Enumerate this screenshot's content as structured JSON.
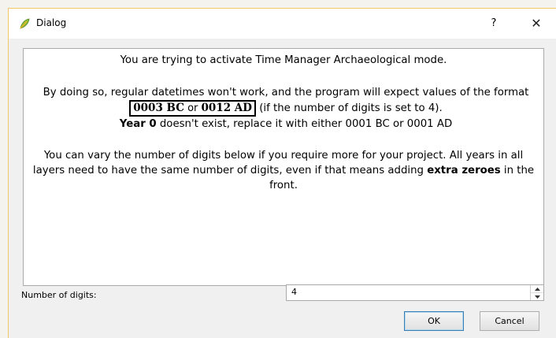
{
  "window": {
    "title": "Dialog",
    "help_label": "?",
    "close_label": "✕"
  },
  "message": {
    "line1": "You are trying to activate Time Manager Archaeological mode.",
    "p2_text1": "By doing so, regular datetimes won't work, and the program will expect values of the format ",
    "fmt_bc": "0003 BC",
    "fmt_or": " or ",
    "fmt_ad": "0012 AD",
    "p2_text2": " (if the number of digits is set to 4).",
    "year0_bold": "Year 0",
    "year0_rest": " doesn't exist, replace it with either 0001 BC or 0001 AD",
    "p3_text1": "You can vary the number of digits below if you require more for your project. All years in all layers need to have the same number of digits, even if that means adding ",
    "p3_bold": "extra zeroes",
    "p3_text2": " in the front."
  },
  "digits": {
    "label": "Number of digits:",
    "value": "4"
  },
  "buttons": {
    "ok": "OK",
    "cancel": "Cancel"
  }
}
